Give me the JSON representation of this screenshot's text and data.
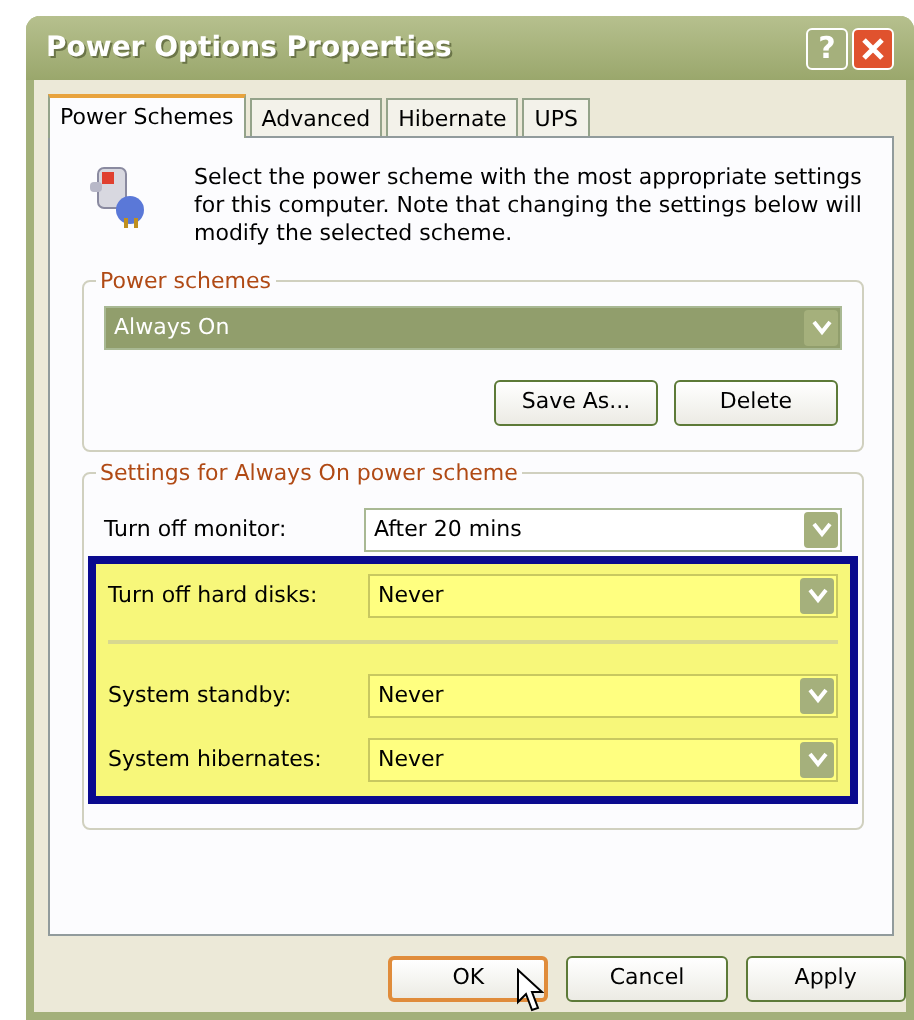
{
  "window": {
    "title": "Power Options Properties",
    "help": "?"
  },
  "tabs": [
    {
      "label": "Power Schemes",
      "selected": true
    },
    {
      "label": "Advanced",
      "selected": false
    },
    {
      "label": "Hibernate",
      "selected": false
    },
    {
      "label": "UPS",
      "selected": false
    }
  ],
  "description": "Select the power scheme with the most appropriate settings for this computer. Note that changing the settings below will modify the selected scheme.",
  "power_schemes": {
    "title": "Power schemes",
    "value": "Always On",
    "focused": true,
    "buttons": [
      "Save As...",
      "Delete"
    ]
  },
  "settings": {
    "title": "Settings for Always On power scheme",
    "rows": [
      {
        "label": "Turn off monitor:",
        "value": "After 20 mins",
        "highlighted": false
      },
      {
        "label": "Turn off hard disks:",
        "value": "Never",
        "highlighted": true
      },
      {
        "label": "System standby:",
        "value": "Never",
        "highlighted": true
      },
      {
        "label": "System hibernates:",
        "value": "Never",
        "highlighted": true
      }
    ]
  },
  "buttons": [
    {
      "label": "OK",
      "default": true
    },
    {
      "label": "Cancel",
      "default": false
    },
    {
      "label": "Apply",
      "default": false
    }
  ]
}
